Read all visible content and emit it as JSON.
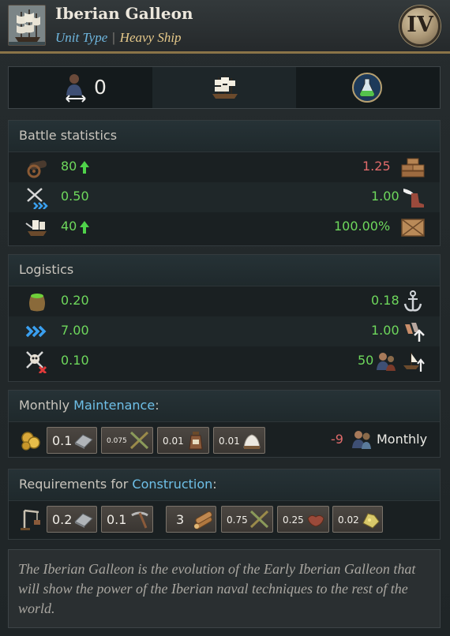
{
  "header": {
    "title": "Iberian Galleon",
    "unit_type_label": "Unit Type",
    "separator": "|",
    "unit_class": "Heavy Ship",
    "rank": "IV"
  },
  "top_stats": {
    "manpower_value": "0",
    "icons": [
      "manpower-icon",
      "ship-type-icon",
      "potion-icon"
    ]
  },
  "battle": {
    "title": "Battle statistics",
    "rows": [
      {
        "left_icon": "cannon-icon",
        "left_value": "80",
        "left_arrow": "up",
        "right_value": "1.25",
        "right_color": "red",
        "right_icon": "bricks-icon"
      },
      {
        "left_icon": "crossed-swords-icon",
        "left_value": "0.50",
        "right_value": "1.00",
        "right_color": "green",
        "right_icon": "winged-boot-icon"
      },
      {
        "left_icon": "ship-attack-icon",
        "left_value": "40",
        "left_arrow": "up",
        "right_value": "100.00%",
        "right_color": "green",
        "right_icon": "crate-icon"
      }
    ]
  },
  "logistics": {
    "title": "Logistics",
    "rows": [
      {
        "left_icon": "supply-sack-icon",
        "left_value": "0.20",
        "right_value": "0.18",
        "right_icon": "anchor-icon"
      },
      {
        "left_icon": "speed-chevrons-icon",
        "left_value": "7.00",
        "right_value": "1.00",
        "right_icon": "hands-up-icon"
      },
      {
        "left_icon": "pirate-skull-icon",
        "left_value": "0.10",
        "right_value": "50",
        "right_icon": "sail-up-icon"
      }
    ]
  },
  "maintenance": {
    "title_prefix": "Monthly ",
    "title_highlight": "Maintenance",
    "title_suffix": ":",
    "items": [
      {
        "value": "0.1",
        "icon": "silver-icon"
      },
      {
        "value": "0.075",
        "icon": "tools-icon"
      },
      {
        "value": "0.01",
        "icon": "jar-icon"
      },
      {
        "value": "0.01",
        "icon": "salt-icon"
      }
    ],
    "pop_value": "-9",
    "pop_label": "Monthly"
  },
  "construction": {
    "title_prefix": "Requirements for ",
    "title_highlight": "Construction",
    "title_suffix": ":",
    "items": [
      {
        "value": "0.2",
        "icon": "silver-icon"
      },
      {
        "value": "0.1",
        "icon": "pickaxe-icon"
      },
      {
        "value": "3",
        "icon": "lumber-icon"
      },
      {
        "value": "0.75",
        "icon": "tools-icon"
      },
      {
        "value": "0.25",
        "icon": "leather-icon"
      },
      {
        "value": "0.02",
        "icon": "gold-icon"
      }
    ]
  },
  "description": "The Iberian Galleon is the evolution of the Early Iberian Galleon that will show the power of the Iberian naval techniques to the rest of the world.",
  "colors": {
    "accent_blue": "#6fb7df",
    "accent_gold": "#e6c98a",
    "positive": "#6ed85c",
    "negative": "#e06a6a"
  }
}
